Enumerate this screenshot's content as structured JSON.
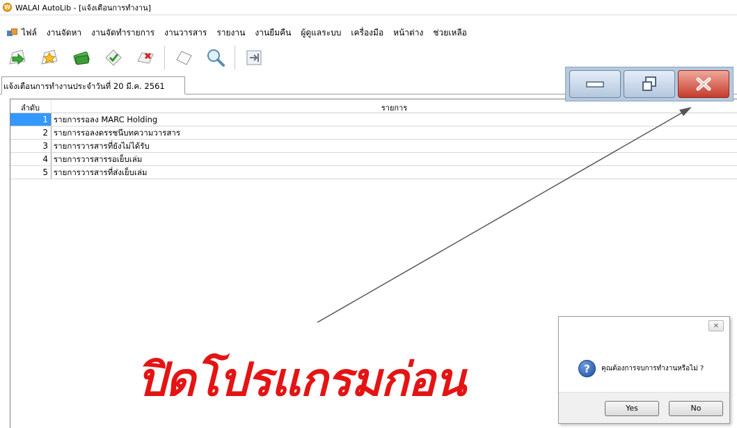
{
  "window": {
    "title": "WALAI AutoLib - [แจ้งเตือนการทำงาน]"
  },
  "menu": {
    "items": [
      "ไฟล์",
      "งานจัดหา",
      "งานจัดทำรายการ",
      "งานวารสาร",
      "รายงาน",
      "งานยืมคืน",
      "ผู้ดูแลระบบ",
      "เครื่องมือ",
      "หน้าต่าง",
      "ช่วยเหลือ"
    ]
  },
  "toolbar": {
    "icons": [
      "forward-arrow-icon",
      "star-icon",
      "money-icon",
      "approve-icon",
      "delete-icon",
      "blank-page-icon",
      "search-icon",
      "exit-icon"
    ]
  },
  "tab": {
    "label": "แจ้งเตือนการทำงานประจำวันที่ 20 มี.ค. 2561"
  },
  "grid": {
    "columns": [
      "ลำดับ",
      "รายการ"
    ],
    "rows": [
      {
        "num": "1",
        "item": "รายการรอลง MARC Holding",
        "selected": true
      },
      {
        "num": "2",
        "item": "รายการรอลงดรรชนีบทความวารสาร",
        "selected": false
      },
      {
        "num": "3",
        "item": "รายการวารสารที่ยังไม่ได้รับ",
        "selected": false
      },
      {
        "num": "4",
        "item": "รายการวารสารรอเย็บเล่ม",
        "selected": false
      },
      {
        "num": "5",
        "item": "รายการวารสารที่ส่งเย็บเล่ม",
        "selected": false
      }
    ]
  },
  "annotation": {
    "text": "ปิดโปรแกรมก่อน",
    "color": "#e41414"
  },
  "dialog": {
    "close_glyph": "✕",
    "message": "คุณต้องการจบการทำงานหรือไม่ ?",
    "yes_label": "Yes",
    "no_label": "No"
  },
  "colors": {
    "selection": "#3399ff",
    "close_button": "#c53c2c"
  }
}
